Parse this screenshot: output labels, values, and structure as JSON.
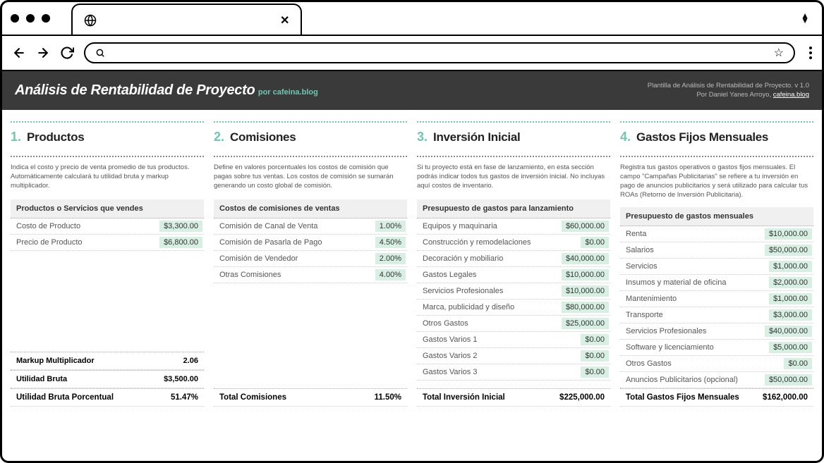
{
  "header": {
    "title": "Análisis de Rentabilidad de Proyecto",
    "by": "por cafeina.blog",
    "right1": "Plantilla de Análisis de Rentabilidad de Proyecto.  v 1.0",
    "right2": "Por Daniel Yanes Arroyo,",
    "right_link": "cafeina.blog"
  },
  "sections": {
    "s1": {
      "num": "1.",
      "title": "Productos",
      "desc": "Indica el costo y precio de venta promedio de tus productos. Automáticamente calculará tu utilidad bruta y markup multiplicador.",
      "subhead": "Productos o Servicios que vendes",
      "rows": [
        {
          "label": "Costo de Producto",
          "value": "$3,300.00",
          "hl": true
        },
        {
          "label": "Precio de Producto",
          "value": "$6,800.00",
          "hl": true
        }
      ],
      "totals": [
        {
          "label": "Markup Multiplicador",
          "value": "2.06"
        },
        {
          "label": "Utilidad Bruta",
          "value": "$3,500.00"
        },
        {
          "label": "Utilidad Bruta Porcentual",
          "value": "51.47%"
        }
      ]
    },
    "s2": {
      "num": "2.",
      "title": "Comisiones",
      "desc": "Define en valores porcentuales los costos de comisión que pagas sobre tus ventas. Los costos de comisión se sumarán generando un costo global de comisión.",
      "subhead": "Costos de comisiones de ventas",
      "rows": [
        {
          "label": "Comisión de Canal de Venta",
          "value": "1.00%",
          "hl": true
        },
        {
          "label": "Comisión de Pasarla de Pago",
          "value": "4.50%",
          "hl": true
        },
        {
          "label": "Comisión de Vendedor",
          "value": "2.00%",
          "hl": true
        },
        {
          "label": "Otras Comisiones",
          "value": "4.00%",
          "hl": true
        }
      ],
      "totals": [
        {
          "label": "Total Comisiones",
          "value": "11.50%"
        }
      ]
    },
    "s3": {
      "num": "3.",
      "title": "Inversión Inicial",
      "desc": "Si tu proyecto está en fase de lanzamiento, en esta sección podrás indicar todos tus gastos de inversión inicial. No incluyas aquí costos de inventario.",
      "subhead": "Presupuesto de gastos para lanzamiento",
      "rows": [
        {
          "label": "Equipos y maquinaria",
          "value": "$60,000.00",
          "hl": true
        },
        {
          "label": "Construcción y remodelaciones",
          "value": "$0.00",
          "hl": true
        },
        {
          "label": "Decoración y mobiliario",
          "value": "$40,000.00",
          "hl": true
        },
        {
          "label": "Gastos Legales",
          "value": "$10,000.00",
          "hl": true
        },
        {
          "label": "Servicios Profesionales",
          "value": "$10,000.00",
          "hl": true
        },
        {
          "label": "Marca, publicidad y diseño",
          "value": "$80,000.00",
          "hl": true
        },
        {
          "label": "Otros Gastos",
          "value": "$25,000.00",
          "hl": true
        },
        {
          "label": "Gastos Varios 1",
          "value": "$0.00",
          "hl": true
        },
        {
          "label": "Gastos Varios 2",
          "value": "$0.00",
          "hl": true
        },
        {
          "label": "Gastos Varios 3",
          "value": "$0.00",
          "hl": true
        }
      ],
      "totals": [
        {
          "label": "Total Inversión Inicial",
          "value": "$225,000.00"
        }
      ]
    },
    "s4": {
      "num": "4.",
      "title": "Gastos Fijos Mensuales",
      "desc": "Registra tus gastos operativos o gastos fijos mensuales. El campo \"Campañas Publicitarias\" se refiere a tu inversión en pago de anuncios publicitarios y será utilizado para calcular tus ROAs (Retorno de Inversión Publicitaria).",
      "subhead": "Presupuesto de gastos mensuales",
      "rows": [
        {
          "label": "Renta",
          "value": "$10,000.00",
          "hl": true
        },
        {
          "label": "Salarios",
          "value": "$50,000.00",
          "hl": true
        },
        {
          "label": "Servicios",
          "value": "$1,000.00",
          "hl": true
        },
        {
          "label": "Insumos y material de oficina",
          "value": "$2,000.00",
          "hl": true
        },
        {
          "label": "Mantenimiento",
          "value": "$1,000.00",
          "hl": true
        },
        {
          "label": "Transporte",
          "value": "$3,000.00",
          "hl": true
        },
        {
          "label": "Servicios Profesionales",
          "value": "$40,000.00",
          "hl": true
        },
        {
          "label": "Software y licenciamiento",
          "value": "$5,000.00",
          "hl": true
        },
        {
          "label": "Otros Gastos",
          "value": "$0.00",
          "hl": true
        },
        {
          "label": "Anuncios Publicitarios (opcional)",
          "value": "$50,000.00",
          "hl": true
        }
      ],
      "totals": [
        {
          "label": "Total Gastos Fijos Mensuales",
          "value": "$162,000.00"
        }
      ]
    }
  }
}
